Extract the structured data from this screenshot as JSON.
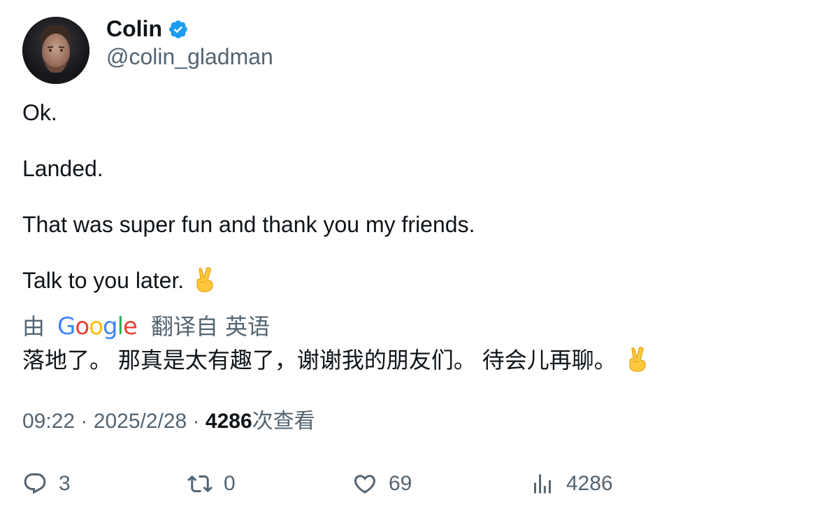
{
  "author": {
    "display_name": "Colin",
    "handle": "@colin_gladman",
    "verified": true
  },
  "tweet": {
    "lines": [
      "Ok.",
      "Landed.",
      "That was super fun and thank you my friends.",
      "Talk to you later."
    ],
    "emoji": "victory-hand-emoji"
  },
  "translation": {
    "prefix": "由",
    "provider_letters": [
      "G",
      "o",
      "o",
      "g",
      "l",
      "e"
    ],
    "provider_colors": [
      "#4285F4",
      "#EA4335",
      "#FBBC05",
      "#4285F4",
      "#34A853",
      "#EA4335"
    ],
    "label": "翻译自",
    "language": "英语",
    "text": "落地了。 那真是太有趣了，谢谢我的朋友们。 待会儿再聊。"
  },
  "meta": {
    "time": "09:22",
    "date": "2025/2/28",
    "separator": "·",
    "views_count": "4286",
    "views_label": "次查看"
  },
  "actions": {
    "replies": "3",
    "retweets": "0",
    "likes": "69",
    "views": "4286"
  },
  "colors": {
    "verified": "#1D9BF0",
    "text_primary": "#0f1419",
    "text_secondary": "#536471"
  }
}
